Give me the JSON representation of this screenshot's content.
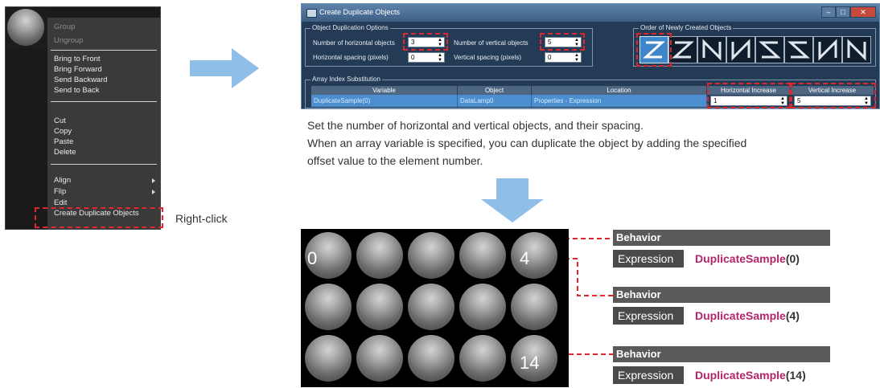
{
  "context_menu": {
    "items_group1": [
      "Group",
      "Ungroup"
    ],
    "items_group2": [
      "Bring to Front",
      "Bring Forward",
      "Send Backward",
      "Send to Back"
    ],
    "items_group3": [
      "Cut",
      "Copy",
      "Paste",
      "Delete"
    ],
    "items_group4": [
      "Align",
      "Flip",
      "Edit",
      "Create Duplicate Objects"
    ]
  },
  "right_click_label": "Right-click",
  "dialog": {
    "title": "Create Duplicate Objects",
    "options_group": "Object Duplication Options",
    "horizontal_objects_label": "Number of horizontal objects",
    "horizontal_objects_value": "3",
    "vertical_objects_label": "Number of vertical objects",
    "vertical_objects_value": "5",
    "horizontal_spacing_label": "Horizontal spacing (pixels)",
    "horizontal_spacing_value": "0",
    "vertical_spacing_label": "Vertical spacing (pixels)",
    "vertical_spacing_value": "0",
    "order_group": "Order of Newly Created Objects",
    "array_group": "Array Index Substitution",
    "columns": [
      "Variable",
      "Object",
      "Location",
      "Horizontal Increase",
      "Vertical Increase"
    ],
    "row": {
      "variable": "DuplicateSample(0)",
      "object": "DataLamp0",
      "location": "Properties - Expression",
      "horizontal_increase": "1",
      "vertical_increase": "5"
    }
  },
  "description": {
    "line1": "Set the number of horizontal and vertical objects, and their spacing.",
    "line2": "When an array variable is specified, you can duplicate the object by adding the specified",
    "line3": "offset value to the element number."
  },
  "ball_labels": {
    "first": "0",
    "fifth": "4",
    "last": "14"
  },
  "behavior_panels": [
    {
      "header": "Behavior",
      "label": "Expression",
      "function": "DuplicateSample",
      "arg": "(0)"
    },
    {
      "header": "Behavior",
      "label": "Expression",
      "function": "DuplicateSample",
      "arg": "(4)"
    },
    {
      "header": "Behavior",
      "label": "Expression",
      "function": "DuplicateSample",
      "arg": "(14)"
    }
  ],
  "colors": {
    "highlight": "#e2262e",
    "arrow": "#8fbfe8",
    "function_text": "#b3246a",
    "selection": "#4b8fd0"
  }
}
